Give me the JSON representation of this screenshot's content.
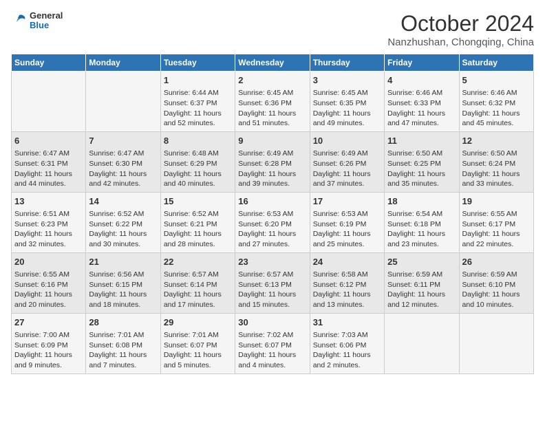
{
  "header": {
    "logo_line1": "General",
    "logo_line2": "Blue",
    "month_title": "October 2024",
    "subtitle": "Nanzhushan, Chongqing, China"
  },
  "weekdays": [
    "Sunday",
    "Monday",
    "Tuesday",
    "Wednesday",
    "Thursday",
    "Friday",
    "Saturday"
  ],
  "weeks": [
    [
      {
        "day": "",
        "info": ""
      },
      {
        "day": "",
        "info": ""
      },
      {
        "day": "1",
        "info": "Sunrise: 6:44 AM\nSunset: 6:37 PM\nDaylight: 11 hours and 52 minutes."
      },
      {
        "day": "2",
        "info": "Sunrise: 6:45 AM\nSunset: 6:36 PM\nDaylight: 11 hours and 51 minutes."
      },
      {
        "day": "3",
        "info": "Sunrise: 6:45 AM\nSunset: 6:35 PM\nDaylight: 11 hours and 49 minutes."
      },
      {
        "day": "4",
        "info": "Sunrise: 6:46 AM\nSunset: 6:33 PM\nDaylight: 11 hours and 47 minutes."
      },
      {
        "day": "5",
        "info": "Sunrise: 6:46 AM\nSunset: 6:32 PM\nDaylight: 11 hours and 45 minutes."
      }
    ],
    [
      {
        "day": "6",
        "info": "Sunrise: 6:47 AM\nSunset: 6:31 PM\nDaylight: 11 hours and 44 minutes."
      },
      {
        "day": "7",
        "info": "Sunrise: 6:47 AM\nSunset: 6:30 PM\nDaylight: 11 hours and 42 minutes."
      },
      {
        "day": "8",
        "info": "Sunrise: 6:48 AM\nSunset: 6:29 PM\nDaylight: 11 hours and 40 minutes."
      },
      {
        "day": "9",
        "info": "Sunrise: 6:49 AM\nSunset: 6:28 PM\nDaylight: 11 hours and 39 minutes."
      },
      {
        "day": "10",
        "info": "Sunrise: 6:49 AM\nSunset: 6:26 PM\nDaylight: 11 hours and 37 minutes."
      },
      {
        "day": "11",
        "info": "Sunrise: 6:50 AM\nSunset: 6:25 PM\nDaylight: 11 hours and 35 minutes."
      },
      {
        "day": "12",
        "info": "Sunrise: 6:50 AM\nSunset: 6:24 PM\nDaylight: 11 hours and 33 minutes."
      }
    ],
    [
      {
        "day": "13",
        "info": "Sunrise: 6:51 AM\nSunset: 6:23 PM\nDaylight: 11 hours and 32 minutes."
      },
      {
        "day": "14",
        "info": "Sunrise: 6:52 AM\nSunset: 6:22 PM\nDaylight: 11 hours and 30 minutes."
      },
      {
        "day": "15",
        "info": "Sunrise: 6:52 AM\nSunset: 6:21 PM\nDaylight: 11 hours and 28 minutes."
      },
      {
        "day": "16",
        "info": "Sunrise: 6:53 AM\nSunset: 6:20 PM\nDaylight: 11 hours and 27 minutes."
      },
      {
        "day": "17",
        "info": "Sunrise: 6:53 AM\nSunset: 6:19 PM\nDaylight: 11 hours and 25 minutes."
      },
      {
        "day": "18",
        "info": "Sunrise: 6:54 AM\nSunset: 6:18 PM\nDaylight: 11 hours and 23 minutes."
      },
      {
        "day": "19",
        "info": "Sunrise: 6:55 AM\nSunset: 6:17 PM\nDaylight: 11 hours and 22 minutes."
      }
    ],
    [
      {
        "day": "20",
        "info": "Sunrise: 6:55 AM\nSunset: 6:16 PM\nDaylight: 11 hours and 20 minutes."
      },
      {
        "day": "21",
        "info": "Sunrise: 6:56 AM\nSunset: 6:15 PM\nDaylight: 11 hours and 18 minutes."
      },
      {
        "day": "22",
        "info": "Sunrise: 6:57 AM\nSunset: 6:14 PM\nDaylight: 11 hours and 17 minutes."
      },
      {
        "day": "23",
        "info": "Sunrise: 6:57 AM\nSunset: 6:13 PM\nDaylight: 11 hours and 15 minutes."
      },
      {
        "day": "24",
        "info": "Sunrise: 6:58 AM\nSunset: 6:12 PM\nDaylight: 11 hours and 13 minutes."
      },
      {
        "day": "25",
        "info": "Sunrise: 6:59 AM\nSunset: 6:11 PM\nDaylight: 11 hours and 12 minutes."
      },
      {
        "day": "26",
        "info": "Sunrise: 6:59 AM\nSunset: 6:10 PM\nDaylight: 11 hours and 10 minutes."
      }
    ],
    [
      {
        "day": "27",
        "info": "Sunrise: 7:00 AM\nSunset: 6:09 PM\nDaylight: 11 hours and 9 minutes."
      },
      {
        "day": "28",
        "info": "Sunrise: 7:01 AM\nSunset: 6:08 PM\nDaylight: 11 hours and 7 minutes."
      },
      {
        "day": "29",
        "info": "Sunrise: 7:01 AM\nSunset: 6:07 PM\nDaylight: 11 hours and 5 minutes."
      },
      {
        "day": "30",
        "info": "Sunrise: 7:02 AM\nSunset: 6:07 PM\nDaylight: 11 hours and 4 minutes."
      },
      {
        "day": "31",
        "info": "Sunrise: 7:03 AM\nSunset: 6:06 PM\nDaylight: 11 hours and 2 minutes."
      },
      {
        "day": "",
        "info": ""
      },
      {
        "day": "",
        "info": ""
      }
    ]
  ]
}
